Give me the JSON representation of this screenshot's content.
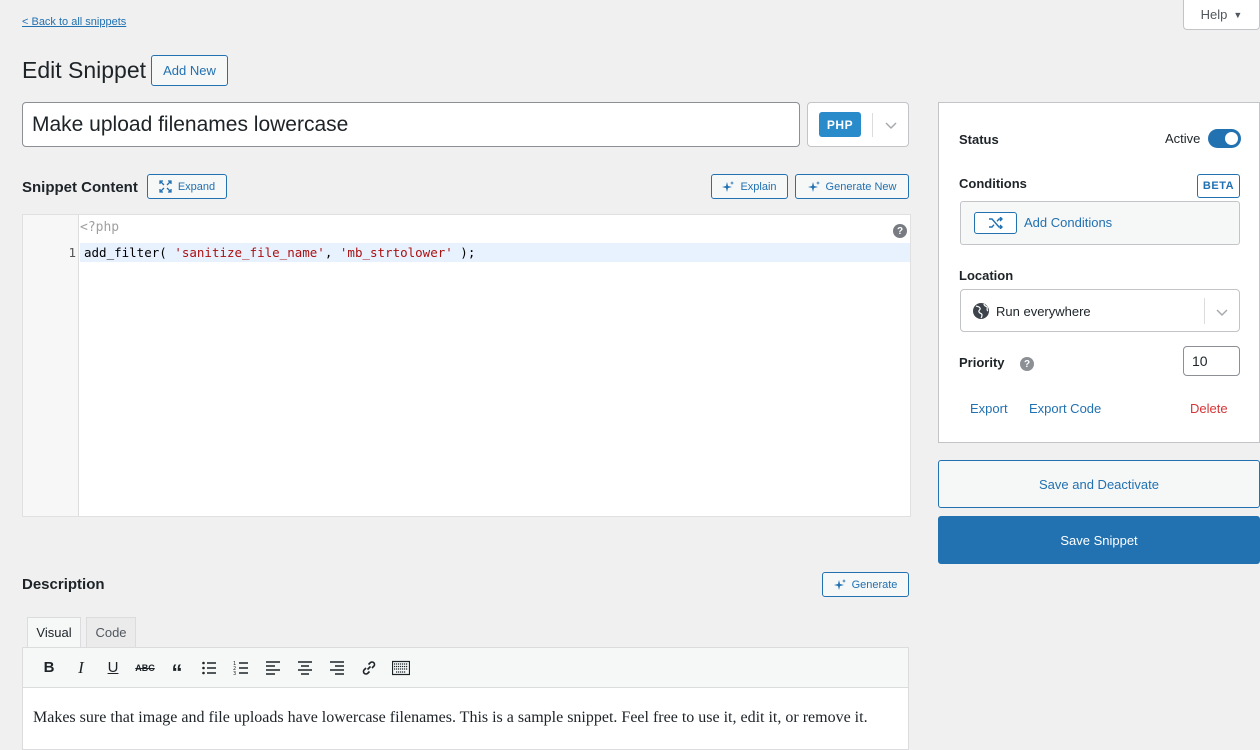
{
  "header": {
    "back_link": "< Back to all snippets",
    "help_label": "Help",
    "page_title": "Edit Snippet",
    "add_new_label": "Add New"
  },
  "snippet": {
    "title_value": "Make upload filenames lowercase",
    "type_badge": "PHP"
  },
  "content": {
    "label": "Snippet Content",
    "expand_label": "Expand",
    "explain_label": "Explain",
    "generate_new_label": "Generate New",
    "php_open_tag": "<?php",
    "line_number": "1",
    "code_parts": [
      "add_filter( ",
      "'sanitize_file_name'",
      ", ",
      "'mb_strtolower'",
      " );"
    ]
  },
  "description": {
    "label": "Description",
    "generate_label": "Generate",
    "tabs": [
      "Visual",
      "Code"
    ],
    "text": "Makes sure that image and file uploads have lowercase filenames. This is a sample snippet. Feel free to use it, edit it, or remove it."
  },
  "sidebar": {
    "status_label": "Status",
    "active_label": "Active",
    "conditions_label": "Conditions",
    "beta_label": "BETA",
    "add_conditions_label": "Add Conditions",
    "location_label": "Location",
    "location_value": "Run everywhere",
    "priority_label": "Priority",
    "priority_value": "10",
    "export_label": "Export",
    "export_code_label": "Export Code",
    "delete_label": "Delete",
    "save_deactivate_label": "Save and Deactivate",
    "save_label": "Save Snippet"
  },
  "colors": {
    "accent": "#2271b1",
    "php_badge": "#2a8bcb",
    "danger": "#d63638",
    "code_string": "#aa1111"
  }
}
